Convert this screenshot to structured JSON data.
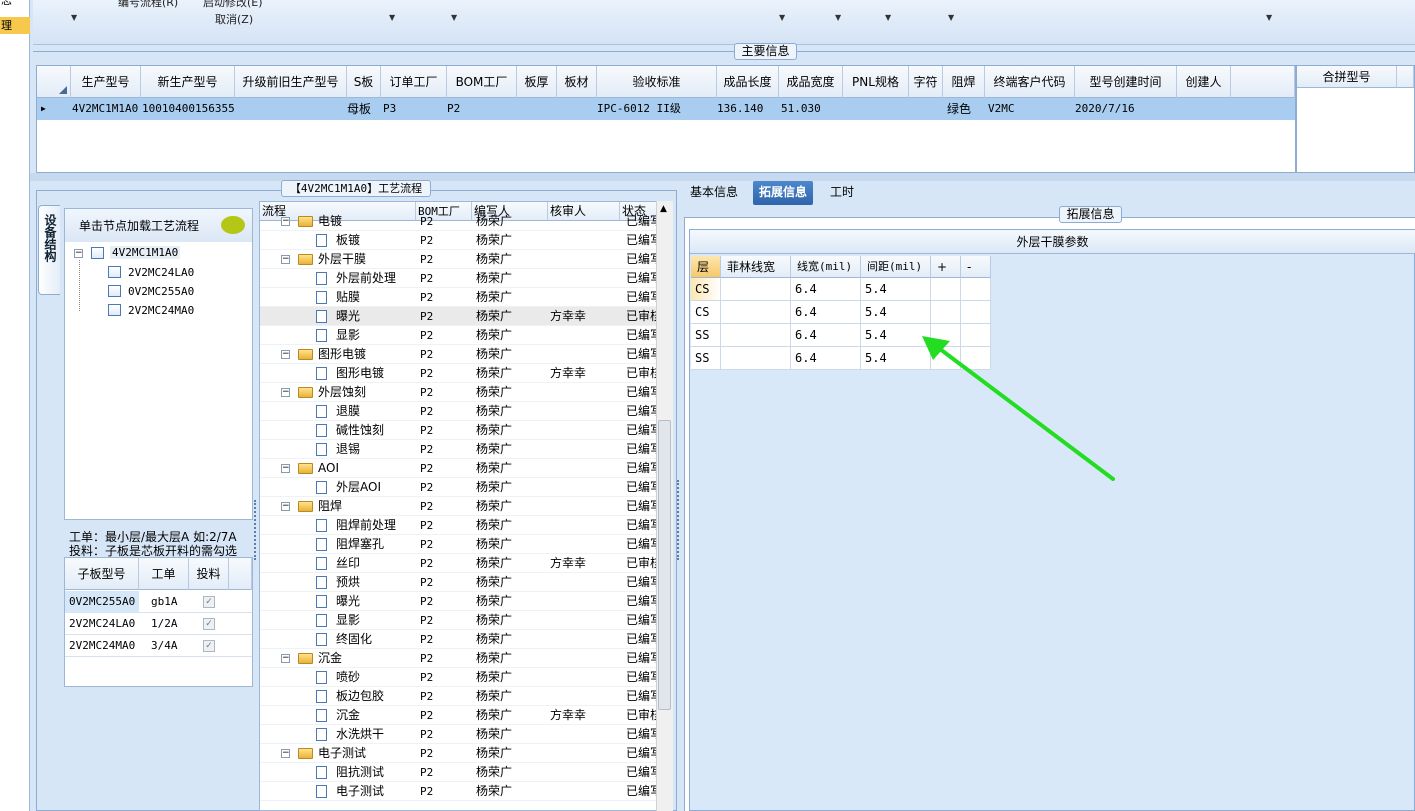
{
  "left_strip": {
    "items": [
      "志",
      "理"
    ]
  },
  "toolbar": {
    "labels": [
      "编号流程(R)",
      "启动修改(E)",
      "取消(Z)"
    ]
  },
  "main_info": {
    "title": "主要信息",
    "columns": [
      "生产型号",
      "新生产型号",
      "升级前旧生产型号",
      "S板",
      "订单工厂",
      "BOM工厂",
      "板厚",
      "板材",
      "验收标准",
      "成品长度",
      "成品宽度",
      "PNL规格",
      "字符",
      "阻焊",
      "终端客户代码",
      "型号创建时间",
      "创建人"
    ],
    "row": {
      "prod_model": "4V2MC1M1A0",
      "new_prod_model": "10010400156355",
      "s_board": "母板",
      "order_factory": "P3",
      "bom_factory": "P2",
      "standard": "IPC-6012 II级",
      "length": "136.140",
      "width": "51.030",
      "solder_mask": "绿色",
      "customer_code": "V2MC",
      "created": "2020/7/16"
    },
    "merge_header": "合拼型号"
  },
  "process_panel": {
    "title": "【4V2MC1M1A0】工艺流程",
    "vertical_tab": "设备结构",
    "tree_hint": "单击节点加载工艺流程",
    "tree": [
      "4V2MC1M1A0",
      "2V2MC24LA0",
      "0V2MC255A0",
      "2V2MC24MA0"
    ],
    "info_line1": "工单：最小层/最大层A 如:2/7A",
    "info_line2": "投料：子板是芯板开料的需勾选",
    "sub_columns": [
      "子板型号",
      "工单",
      "投料"
    ],
    "sub_rows": [
      {
        "model": "0V2MC255A0",
        "order": "gb1A"
      },
      {
        "model": "2V2MC24LA0",
        "order": "1/2A"
      },
      {
        "model": "2V2MC24MA0",
        "order": "3/4A"
      }
    ],
    "grid_columns": [
      "流程",
      "BOM工厂",
      "编写人",
      "核审人",
      "状态"
    ],
    "grid_rows": [
      {
        "level": 0,
        "name": "电镀",
        "bom": "P2",
        "writer": "杨荣广",
        "reviewer": "",
        "status": "已编写"
      },
      {
        "level": 1,
        "name": "板镀",
        "bom": "P2",
        "writer": "杨荣广",
        "reviewer": "",
        "status": "已编写"
      },
      {
        "level": 0,
        "name": "外层干膜",
        "bom": "P2",
        "writer": "杨荣广",
        "reviewer": "",
        "status": "已编写"
      },
      {
        "level": 1,
        "name": "外层前处理",
        "bom": "P2",
        "writer": "杨荣广",
        "reviewer": "",
        "status": "已编写"
      },
      {
        "level": 1,
        "name": "贴膜",
        "bom": "P2",
        "writer": "杨荣广",
        "reviewer": "",
        "status": "已编写"
      },
      {
        "level": 1,
        "name": "曝光",
        "bom": "P2",
        "writer": "杨荣广",
        "reviewer": "方幸幸",
        "status": "已审核"
      },
      {
        "level": 1,
        "name": "显影",
        "bom": "P2",
        "writer": "杨荣广",
        "reviewer": "",
        "status": "已编写"
      },
      {
        "level": 0,
        "name": "图形电镀",
        "bom": "P2",
        "writer": "杨荣广",
        "reviewer": "",
        "status": "已编写"
      },
      {
        "level": 1,
        "name": "图形电镀",
        "bom": "P2",
        "writer": "杨荣广",
        "reviewer": "方幸幸",
        "status": "已审核"
      },
      {
        "level": 0,
        "name": "外层蚀刻",
        "bom": "P2",
        "writer": "杨荣广",
        "reviewer": "",
        "status": "已编写"
      },
      {
        "level": 1,
        "name": "退膜",
        "bom": "P2",
        "writer": "杨荣广",
        "reviewer": "",
        "status": "已编写"
      },
      {
        "level": 1,
        "name": "碱性蚀刻",
        "bom": "P2",
        "writer": "杨荣广",
        "reviewer": "",
        "status": "已编写"
      },
      {
        "level": 1,
        "name": "退锡",
        "bom": "P2",
        "writer": "杨荣广",
        "reviewer": "",
        "status": "已编写"
      },
      {
        "level": 0,
        "name": "AOI",
        "bom": "P2",
        "writer": "杨荣广",
        "reviewer": "",
        "status": "已编写"
      },
      {
        "level": 1,
        "name": "外层AOI",
        "bom": "P2",
        "writer": "杨荣广",
        "reviewer": "",
        "status": "已编写"
      },
      {
        "level": 0,
        "name": "阻焊",
        "bom": "P2",
        "writer": "杨荣广",
        "reviewer": "",
        "status": "已编写"
      },
      {
        "level": 1,
        "name": "阻焊前处理",
        "bom": "P2",
        "writer": "杨荣广",
        "reviewer": "",
        "status": "已编写"
      },
      {
        "level": 1,
        "name": "阻焊塞孔",
        "bom": "P2",
        "writer": "杨荣广",
        "reviewer": "",
        "status": "已编写"
      },
      {
        "level": 1,
        "name": "丝印",
        "bom": "P2",
        "writer": "杨荣广",
        "reviewer": "方幸幸",
        "status": "已审核"
      },
      {
        "level": 1,
        "name": "预烘",
        "bom": "P2",
        "writer": "杨荣广",
        "reviewer": "",
        "status": "已编写"
      },
      {
        "level": 1,
        "name": "曝光",
        "bom": "P2",
        "writer": "杨荣广",
        "reviewer": "",
        "status": "已编写"
      },
      {
        "level": 1,
        "name": "显影",
        "bom": "P2",
        "writer": "杨荣广",
        "reviewer": "",
        "status": "已编写"
      },
      {
        "level": 1,
        "name": "终固化",
        "bom": "P2",
        "writer": "杨荣广",
        "reviewer": "",
        "status": "已编写"
      },
      {
        "level": 0,
        "name": "沉金",
        "bom": "P2",
        "writer": "杨荣广",
        "reviewer": "",
        "status": "已编写"
      },
      {
        "level": 1,
        "name": "喷砂",
        "bom": "P2",
        "writer": "杨荣广",
        "reviewer": "",
        "status": "已编写"
      },
      {
        "level": 1,
        "name": "板边包胶",
        "bom": "P2",
        "writer": "杨荣广",
        "reviewer": "",
        "status": "已编写"
      },
      {
        "level": 1,
        "name": "沉金",
        "bom": "P2",
        "writer": "杨荣广",
        "reviewer": "方幸幸",
        "status": "已审核"
      },
      {
        "level": 1,
        "name": "水洗烘干",
        "bom": "P2",
        "writer": "杨荣广",
        "reviewer": "",
        "status": "已编写"
      },
      {
        "level": 0,
        "name": "电子测试",
        "bom": "P2",
        "writer": "杨荣广",
        "reviewer": "",
        "status": "已编写"
      },
      {
        "level": 1,
        "name": "阻抗测试",
        "bom": "P2",
        "writer": "杨荣广",
        "reviewer": "",
        "status": "已编写"
      },
      {
        "level": 1,
        "name": "电子测试",
        "bom": "P2",
        "writer": "杨荣广",
        "reviewer": "",
        "status": "已编写"
      }
    ]
  },
  "right_panel": {
    "tabs": [
      "基本信息",
      "拓展信息",
      "工时"
    ],
    "ext_title": "拓展信息",
    "param_title": "外层干膜参数",
    "columns": [
      "层",
      "菲林线宽",
      "线宽(mil)",
      "间距(mil)",
      "+",
      "-"
    ],
    "rows": [
      {
        "layer": "CS",
        "film": "",
        "width": "6.4",
        "space": "5.4"
      },
      {
        "layer": "CS",
        "film": "",
        "width": "6.4",
        "space": "5.4"
      },
      {
        "layer": "SS",
        "film": "",
        "width": "6.4",
        "space": "5.4"
      },
      {
        "layer": "SS",
        "film": "",
        "width": "6.4",
        "space": "5.4"
      }
    ],
    "arrow_color": "#22dd22"
  }
}
